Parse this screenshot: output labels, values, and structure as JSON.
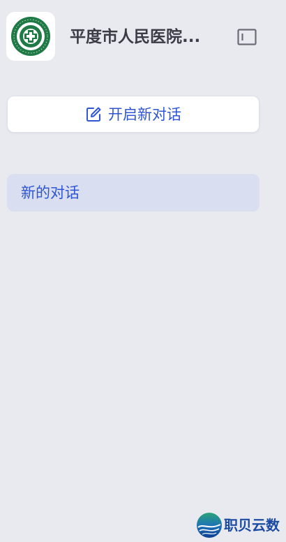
{
  "header": {
    "title": "平度市人民医院...",
    "logo_icon": "hospital-logo-icon",
    "toggle_icon": "sidebar-toggle-icon"
  },
  "new_chat_button": {
    "label": "开启新对话",
    "icon": "edit-icon"
  },
  "conversations": [
    {
      "label": "新的对话",
      "active": true
    }
  ],
  "footer": {
    "brand_name": "职贝云数",
    "brand_icon": "globe-logo-icon"
  },
  "colors": {
    "background": "#e9eaf0",
    "accent": "#2f55d4",
    "active_item_bg": "#d9dff0",
    "logo_green": "#1f7a45",
    "brand_blue": "#1b4aa3"
  }
}
